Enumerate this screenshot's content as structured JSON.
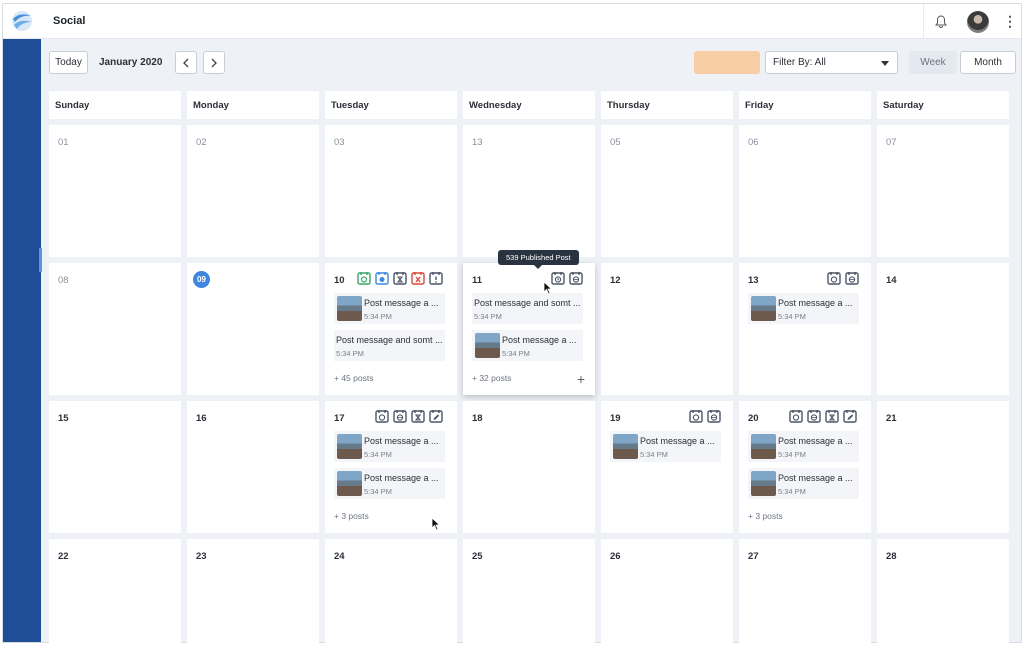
{
  "app": {
    "title": "Social"
  },
  "header": {
    "notifications_icon": "bell-icon",
    "avatar": "user-avatar",
    "menu_icon": "kebab-icon"
  },
  "toolbar": {
    "today": "Today",
    "month_label": "January 2020",
    "filter_label": "Filter By: All",
    "week": "Week",
    "month": "Month",
    "accent": "#f8cda5"
  },
  "weekdays": [
    "Sunday",
    "Monday",
    "Tuesday",
    "Wednesday",
    "Thursday",
    "Friday",
    "Saturday"
  ],
  "week1": [
    "01",
    "02",
    "03",
    "13",
    "05",
    "06",
    "07"
  ],
  "week2": [
    "08",
    "09",
    "10",
    "11",
    "12",
    "13",
    "14"
  ],
  "week3": [
    "15",
    "16",
    "17",
    "18",
    "19",
    "20",
    "21"
  ],
  "week4": [
    "22",
    "23",
    "24",
    "25",
    "26",
    "27",
    "28"
  ],
  "posts": {
    "tue10": [
      {
        "title": "Post message a ...",
        "time": "5:34 PM"
      },
      {
        "title": "Post message and somt ...",
        "time": "5:34 PM"
      }
    ],
    "tue10_more": "+ 45 posts",
    "wed11": [
      {
        "title": "Post message and somt ...",
        "time": "5:34 PM"
      },
      {
        "title": "Post message a ...",
        "time": "5:34 PM"
      }
    ],
    "wed11_more": "+ 32 posts",
    "fri13": [
      {
        "title": "Post message a ...",
        "time": "5:34 PM"
      }
    ],
    "tue17": [
      {
        "title": "Post message a ...",
        "time": "5:34 PM"
      },
      {
        "title": "Post message a ...",
        "time": "5:34 PM"
      }
    ],
    "tue17_more": "+ 3 posts",
    "thu19": [
      {
        "title": "Post message a ...",
        "time": "5:34 PM"
      }
    ],
    "fri20": [
      {
        "title": "Post message a ...",
        "time": "5:34 PM"
      },
      {
        "title": "Post message a ...",
        "time": "5:34 PM"
      }
    ],
    "fri20_more": "+ 3 posts"
  },
  "tooltip": "539 Published Post",
  "colors": {
    "sidebar": "#1f4e97",
    "today": "#3f86e0",
    "published": "#3aa66a",
    "scheduled": "#3f86e0",
    "failed": "#d64a3a",
    "icon_default": "#4c5566"
  }
}
